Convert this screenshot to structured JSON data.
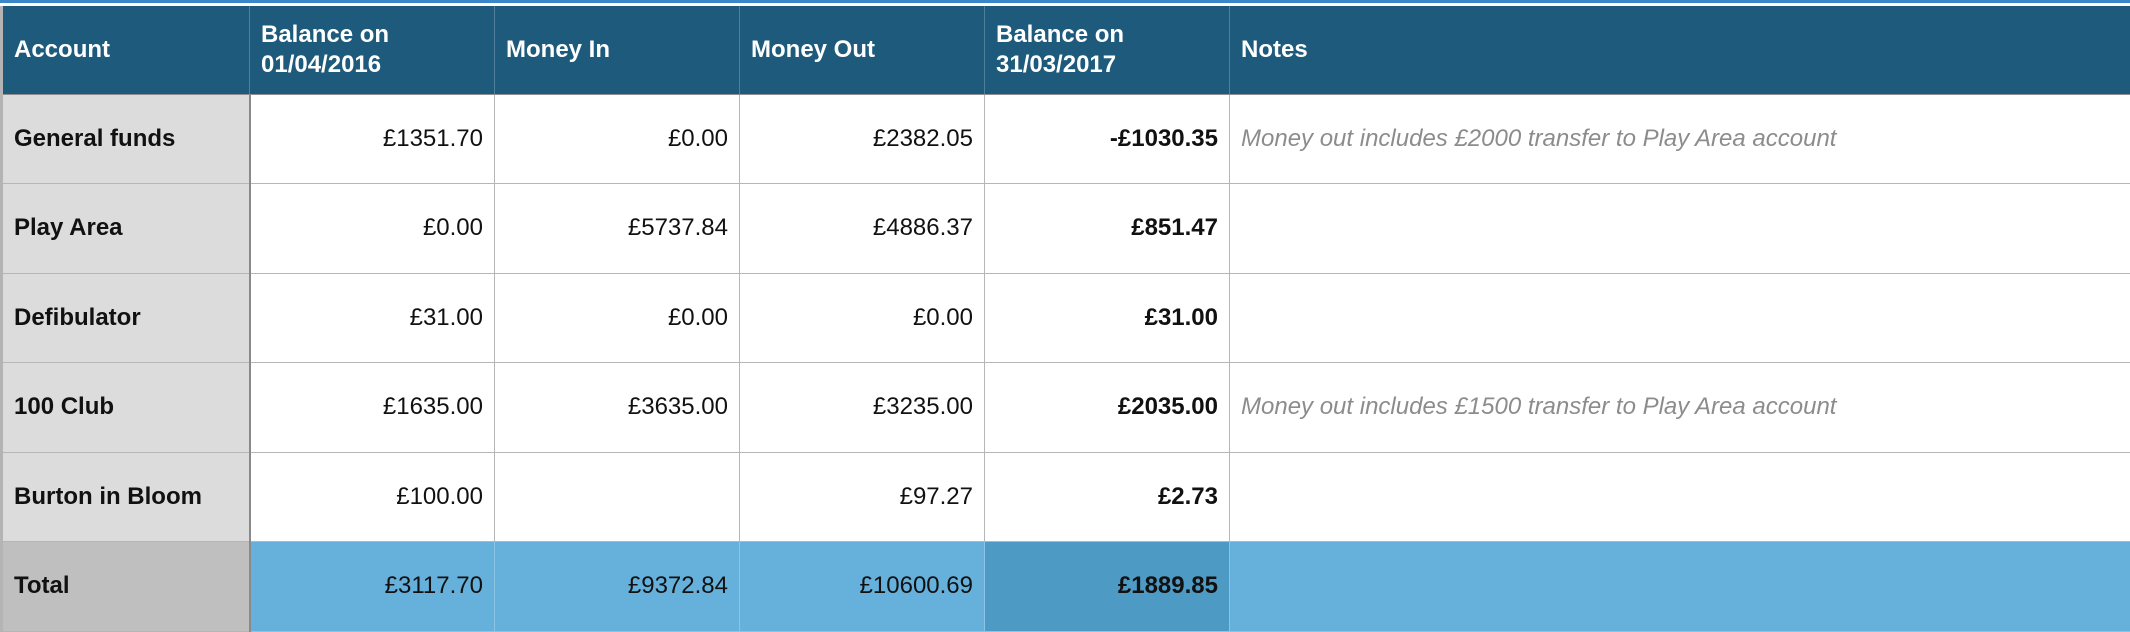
{
  "table": {
    "headers": {
      "account": "Account",
      "balance_start_line1": "Balance on",
      "balance_start_line2": "01/04/2016",
      "money_in": "Money In",
      "money_out": "Money Out",
      "balance_end_line1": "Balance on",
      "balance_end_line2": "31/03/2017",
      "notes": "Notes"
    },
    "rows": [
      {
        "account": "General funds",
        "balance_start": "£1351.70",
        "money_in": "£0.00",
        "money_out": "£2382.05",
        "balance_end": "-£1030.35",
        "notes": "Money out includes £2000 transfer to Play Area account"
      },
      {
        "account": "Play Area",
        "balance_start": "£0.00",
        "money_in": "£5737.84",
        "money_out": "£4886.37",
        "balance_end": "£851.47",
        "notes": ""
      },
      {
        "account": "Defibulator",
        "balance_start": "£31.00",
        "money_in": "£0.00",
        "money_out": "£0.00",
        "balance_end": "£31.00",
        "notes": ""
      },
      {
        "account": "100 Club",
        "balance_start": "£1635.00",
        "money_in": "£3635.00",
        "money_out": "£3235.00",
        "balance_end": "£2035.00",
        "notes": "Money out includes £1500 transfer to Play Area account"
      },
      {
        "account": "Burton in Bloom",
        "balance_start": "£100.00",
        "money_in": "",
        "money_out": "£97.27",
        "balance_end": "£2.73",
        "notes": ""
      }
    ],
    "total": {
      "account": "Total",
      "balance_start": "£3117.70",
      "money_in": "£9372.84",
      "money_out": "£10600.69",
      "balance_end": "£1889.85",
      "notes": ""
    }
  },
  "colors": {
    "header_bg": "#1d5a7c",
    "account_col_bg": "#dcdcdc",
    "total_row_bg": "#66b1dc",
    "total_highlight_bg": "#4d9ac5",
    "total_label_bg": "#bfbfbf",
    "notes_text": "#8c8c8c"
  }
}
